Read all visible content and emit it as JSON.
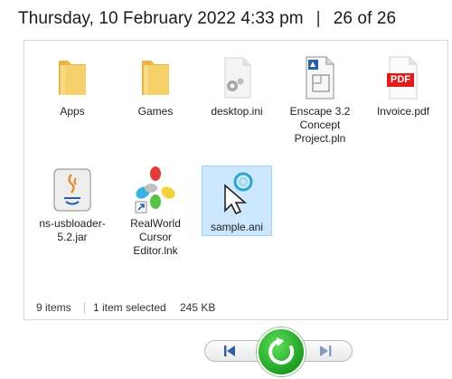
{
  "header": {
    "datetime": "Thursday, 10 February 2022 4:33 pm",
    "separator": "|",
    "position": "26 of 26"
  },
  "files": [
    {
      "label": "Apps",
      "icon": "folder-icon"
    },
    {
      "label": "Games",
      "icon": "folder-icon"
    },
    {
      "label": "desktop.ini",
      "icon": "settings-file-icon"
    },
    {
      "label": "Enscape 3.2 Concept Project.pln",
      "icon": "pln-file-icon"
    },
    {
      "label": "Invoice.pdf",
      "icon": "pdf-file-icon"
    },
    {
      "label": "ns-usbloader-5.2.jar",
      "icon": "java-jar-icon"
    },
    {
      "label": "RealWorld Cursor Editor.lnk",
      "icon": "cursor-editor-shortcut-icon"
    },
    {
      "label": "sample.ani",
      "icon": "animated-cursor-icon",
      "selected": true
    }
  ],
  "pdf_badge": "PDF",
  "status": {
    "items": "9 items",
    "selected": "1 item selected",
    "size": "245 KB"
  },
  "nav": {
    "prev_icon": "previous-icon",
    "refresh_icon": "refresh-icon",
    "next_icon": "next-icon"
  },
  "colors": {
    "folder": "#f3c85f",
    "selection_bg": "#cce8ff",
    "selection_border": "#99d1ff",
    "refresh_green": "#2fb52e",
    "pdf_red": "#e21b1b",
    "nav_blue": "#2a5fa8"
  }
}
